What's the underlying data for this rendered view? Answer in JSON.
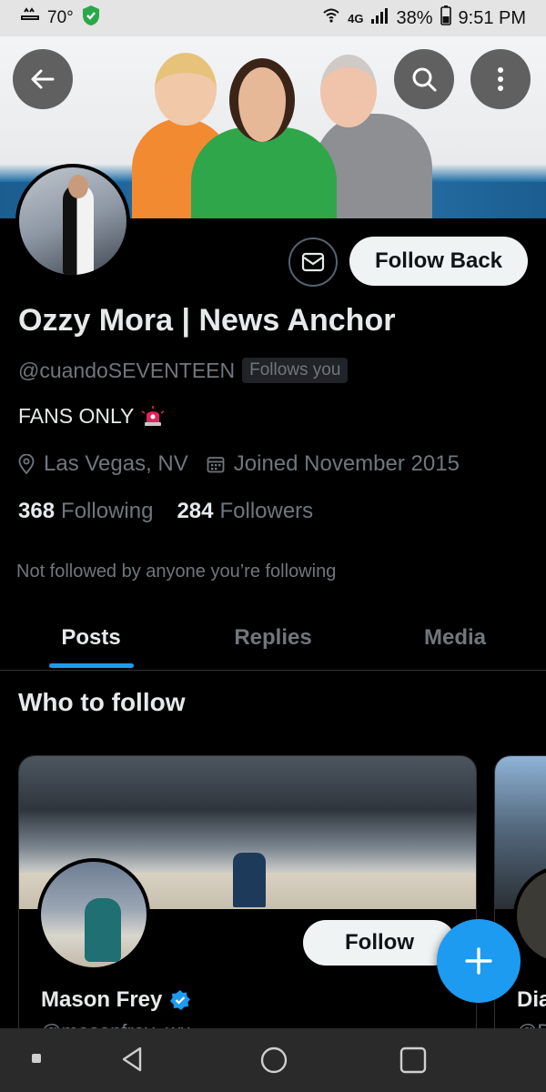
{
  "status_bar": {
    "temperature": "70°",
    "network": "4G",
    "battery": "38%",
    "time": "9:51 PM"
  },
  "header": {
    "back_icon": "back-arrow-icon",
    "search_icon": "search-icon",
    "more_icon": "more-vertical-icon"
  },
  "profile": {
    "name": "Ozzy Mora | News Anchor",
    "handle": "@cuandoSEVENTEEN",
    "follows_you_badge": "Follows you",
    "bio": "FANS ONLY",
    "location": "Las Vegas, NV",
    "joined": "Joined November 2015",
    "following_count": "368",
    "following_label": "Following",
    "followers_count": "284",
    "followers_label": "Followers",
    "not_followed_text": "Not followed by anyone you’re following"
  },
  "actions": {
    "message_icon": "mail-icon",
    "follow_back_label": "Follow Back"
  },
  "tabs": [
    {
      "label": "Posts",
      "active": true
    },
    {
      "label": "Replies",
      "active": false
    },
    {
      "label": "Media",
      "active": false
    }
  ],
  "who_to_follow": {
    "title": "Who to follow",
    "cards": [
      {
        "name": "Mason Frey",
        "handle": "@masonfrey_wx",
        "verified": true,
        "button": "Follow"
      },
      {
        "name": "Dia",
        "handle": "@D"
      }
    ]
  },
  "colors": {
    "accent": "#1d9bf0",
    "background": "#000000",
    "muted": "#71767b"
  }
}
